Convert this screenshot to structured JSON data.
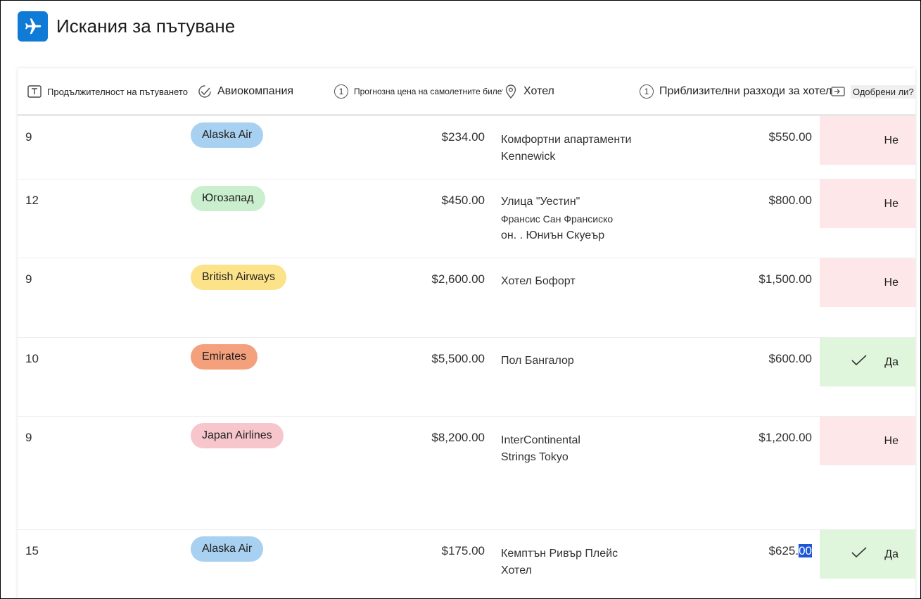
{
  "app": {
    "title": "Искания за пътуване",
    "logo_icon": "airplane-icon",
    "logo_color": "#0f7bd7"
  },
  "columns": {
    "duration": {
      "label": "Продължителност на пътуването",
      "icon": "text-field-icon"
    },
    "airline": {
      "label": "Авиокомпания",
      "icon": "choice-check-icon"
    },
    "ticket_price": {
      "label": "Прогнозна цена на самолетните билети",
      "icon": "number-icon",
      "icon_text": "1"
    },
    "hotel": {
      "label": "Хотел",
      "icon": "location-pin-icon"
    },
    "hotel_cost": {
      "label": "Приблизителни разходи за хотел",
      "icon": "number-icon",
      "icon_text": "1"
    },
    "approved": {
      "label": "Одобрени ли?",
      "icon": "yes-no-icon"
    }
  },
  "rows": [
    {
      "duration": "9",
      "airline": "Alaska Air",
      "airline_color": "#a8d0f0",
      "price": "$234.00",
      "hotel_lines": [
        "Комфортни апартаменти",
        "Kennewick"
      ],
      "cost": "$550.00",
      "approved": "Не",
      "approved_bg": "#fde7e9"
    },
    {
      "duration": "12",
      "airline": "Югозапад",
      "airline_color": "#c9efce",
      "price": "$450.00",
      "hotel_lines": [
        "Улица \"Уестин\"",
        "Франсис Сан  Франсиско",
        "он. .  Юниън Скуеър"
      ],
      "cost": "$800.00",
      "approved": "Не",
      "approved_bg": "#fde7e9"
    },
    {
      "duration": "9",
      "airline": "British Airways",
      "airline_color": "#fce38a",
      "price": "$2,600.00",
      "hotel_lines": [
        "Хотел Бофорт"
      ],
      "cost": "$1,500.00",
      "approved": "Не",
      "approved_bg": "#fde7e9"
    },
    {
      "duration": "10",
      "airline": "Emirates",
      "airline_color": "#f4a07c",
      "price": "$5,500.00",
      "hotel_lines": [
        "Пол Бангалор"
      ],
      "cost": "$600.00",
      "approved": "Да",
      "approved_bg": "#dff6dd"
    },
    {
      "duration": "9",
      "airline": "Japan Airlines",
      "airline_color": "#f7c6cc",
      "price": "$8,200.00",
      "hotel_lines": [
        "InterContinental",
        "Strings Tokyo"
      ],
      "cost": "$1,200.00",
      "approved": "Не",
      "approved_bg": "#fde7e9"
    },
    {
      "duration": "15",
      "airline": "Alaska Air",
      "airline_color": "#a8d0f0",
      "price": "$175.00",
      "hotel_lines": [
        "Кемптън Ривър Плейс",
        "Хотел"
      ],
      "cost_main": "$625.",
      "cost_selected": "00",
      "approved": "Да",
      "approved_bg": "#dff6dd"
    }
  ]
}
